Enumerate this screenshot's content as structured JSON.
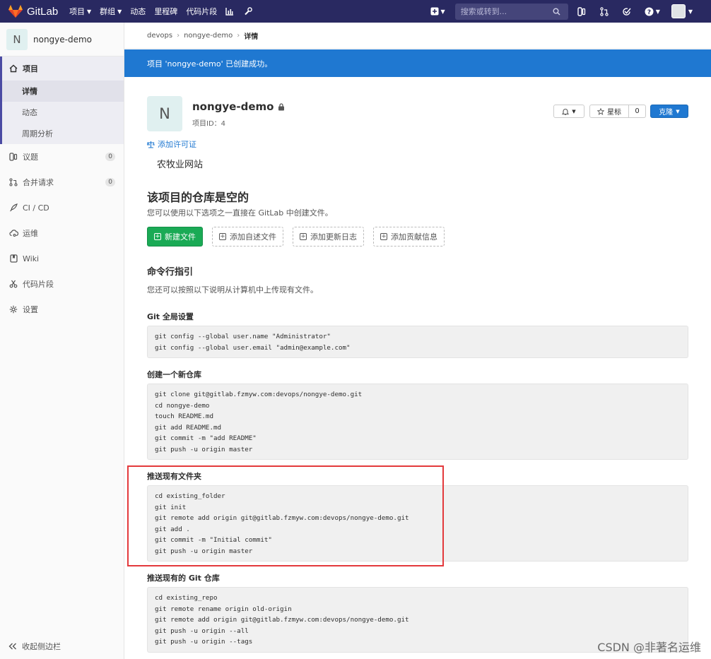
{
  "navbar": {
    "brand": "GitLab",
    "links": [
      {
        "label": "项目",
        "caret": true
      },
      {
        "label": "群组",
        "caret": true
      },
      {
        "label": "动态",
        "caret": false
      },
      {
        "label": "里程碑",
        "caret": false
      },
      {
        "label": "代码片段",
        "caret": false
      }
    ],
    "search_placeholder": "搜索或转到..."
  },
  "sidebar": {
    "project_initial": "N",
    "project_name": "nongye-demo",
    "project_label": "项目",
    "sub_items": [
      "详情",
      "动态",
      "周期分析"
    ],
    "issues_label": "议题",
    "issues_count": "0",
    "mr_label": "合并请求",
    "mr_count": "0",
    "cicd_label": "CI / CD",
    "ops_label": "运维",
    "wiki_label": "Wiki",
    "snippets_label": "代码片段",
    "settings_label": "设置",
    "collapse_label": "收起侧边栏"
  },
  "breadcrumb": {
    "group": "devops",
    "project": "nongye-demo",
    "current": "详情"
  },
  "flash": "项目 'nongye-demo' 已创建成功。",
  "project": {
    "initial": "N",
    "name": "nongye-demo",
    "id_label": "项目ID：4",
    "star_label": "星标",
    "star_count": "0",
    "clone_label": "克隆",
    "license_link": "添加许可证",
    "description": "农牧业网站"
  },
  "empty": {
    "title": "该项目的仓库是空的",
    "subtitle": "您可以使用以下选项之一直接在 GitLab 中创建文件。",
    "new_file": "新建文件",
    "add_readme": "添加自述文件",
    "add_changelog": "添加更新日志",
    "add_contributing": "添加贡献信息"
  },
  "cli": {
    "title": "命令行指引",
    "subtitle": "您还可以按照以下说明从计算机中上传现有文件。",
    "sections": [
      {
        "title": "Git 全局设置",
        "code": "git config --global user.name \"Administrator\"\ngit config --global user.email \"admin@example.com\""
      },
      {
        "title": "创建一个新仓库",
        "code": "git clone git@gitlab.fzmyw.com:devops/nongye-demo.git\ncd nongye-demo\ntouch README.md\ngit add README.md\ngit commit -m \"add README\"\ngit push -u origin master"
      },
      {
        "title": "推送现有文件夹",
        "code": "cd existing_folder\ngit init\ngit remote add origin git@gitlab.fzmyw.com:devops/nongye-demo.git\ngit add .\ngit commit -m \"Initial commit\"\ngit push -u origin master"
      },
      {
        "title": "推送现有的 Git 仓库",
        "code": "cd existing_repo\ngit remote rename origin old-origin\ngit remote add origin git@gitlab.fzmyw.com:devops/nongye-demo.git\ngit push -u origin --all\ngit push -u origin --tags"
      }
    ]
  },
  "watermark": "CSDN @非著名运维",
  "colors": {
    "navbar": "#292961",
    "flash": "#1f78d1",
    "primary_button": "#1f78d1",
    "success_button": "#1aaa55",
    "highlight": "#e3393c"
  }
}
